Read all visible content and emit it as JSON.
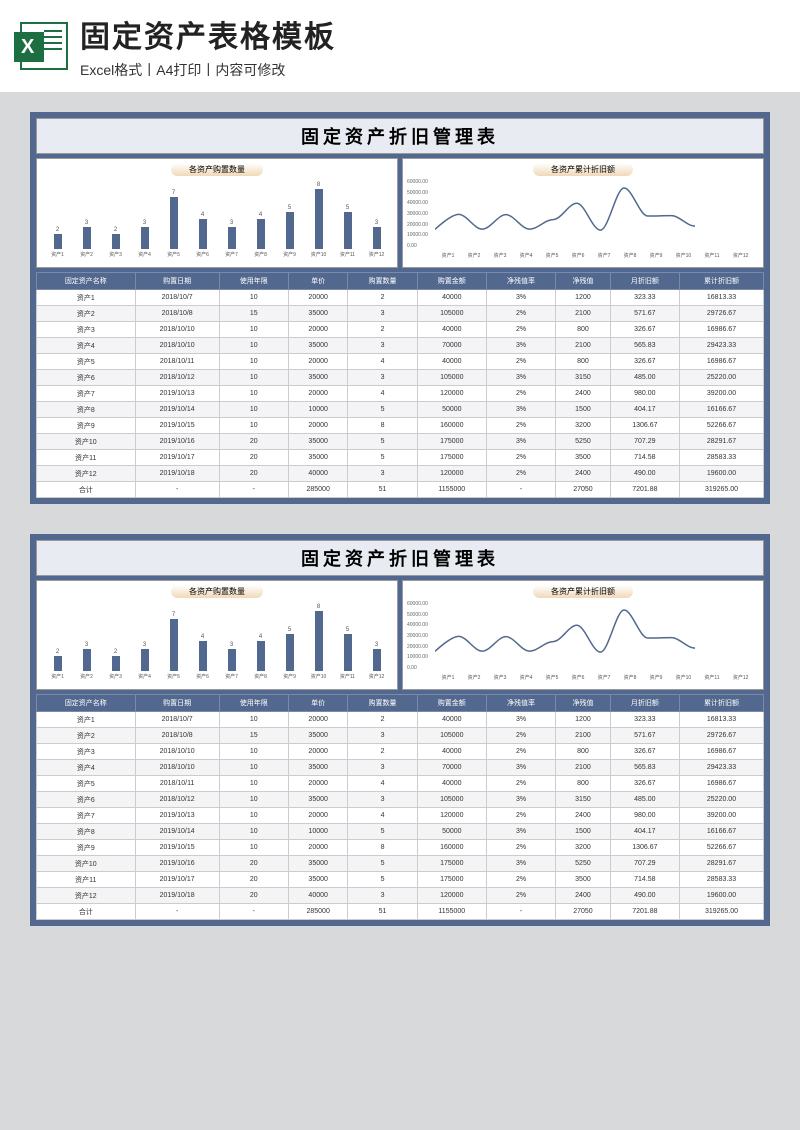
{
  "header": {
    "title": "固定资产表格模板",
    "subtitle": "Excel格式丨A4打印丨内容可修改"
  },
  "sheet": {
    "title": "固定资产折旧管理表",
    "chart1_title": "各资产购置数量",
    "chart2_title": "各资产累计折旧额"
  },
  "chart_data": [
    {
      "type": "bar",
      "title": "各资产购置数量",
      "categories": [
        "资产1",
        "资产2",
        "资产3",
        "资产4",
        "资产5",
        "资产6",
        "资产7",
        "资产8",
        "资产9",
        "资产10",
        "资产11",
        "资产12"
      ],
      "values": [
        2,
        3,
        2,
        3,
        7,
        4,
        3,
        4,
        5,
        8,
        5,
        3
      ],
      "ylim": [
        0,
        8
      ]
    },
    {
      "type": "line",
      "title": "各资产累计折旧额",
      "categories": [
        "资产1",
        "资产2",
        "资产3",
        "资产4",
        "资产5",
        "资产6",
        "资产7",
        "资产8",
        "资产9",
        "资产10",
        "资产11",
        "资产12"
      ],
      "values": [
        16813,
        29726,
        16986,
        29423,
        16986,
        25220,
        39200,
        16166,
        52266,
        28291,
        28583,
        19600
      ],
      "ylim": [
        0,
        60000
      ],
      "yticks": [
        "60000.00",
        "50000.00",
        "40000.00",
        "30000.00",
        "20000.00",
        "10000.00",
        "0.00"
      ]
    }
  ],
  "table": {
    "headers": [
      "固定资产名称",
      "购置日期",
      "使用年限",
      "单价",
      "购置数量",
      "购置金额",
      "净残值率",
      "净残值",
      "月折旧额",
      "累计折旧额"
    ],
    "rows": [
      [
        "资产1",
        "2018/10/7",
        "10",
        "20000",
        "2",
        "40000",
        "3%",
        "1200",
        "323.33",
        "16813.33"
      ],
      [
        "资产2",
        "2018/10/8",
        "15",
        "35000",
        "3",
        "105000",
        "2%",
        "2100",
        "571.67",
        "29726.67"
      ],
      [
        "资产3",
        "2018/10/10",
        "10",
        "20000",
        "2",
        "40000",
        "2%",
        "800",
        "326.67",
        "16986.67"
      ],
      [
        "资产4",
        "2018/10/10",
        "10",
        "35000",
        "3",
        "70000",
        "3%",
        "2100",
        "565.83",
        "29423.33"
      ],
      [
        "资产5",
        "2018/10/11",
        "10",
        "20000",
        "4",
        "40000",
        "2%",
        "800",
        "326.67",
        "16986.67"
      ],
      [
        "资产6",
        "2018/10/12",
        "10",
        "35000",
        "3",
        "105000",
        "3%",
        "3150",
        "485.00",
        "25220.00"
      ],
      [
        "资产7",
        "2019/10/13",
        "10",
        "20000",
        "4",
        "120000",
        "2%",
        "2400",
        "980.00",
        "39200.00"
      ],
      [
        "资产8",
        "2019/10/14",
        "10",
        "10000",
        "5",
        "50000",
        "3%",
        "1500",
        "404.17",
        "16166.67"
      ],
      [
        "资产9",
        "2019/10/15",
        "10",
        "20000",
        "8",
        "160000",
        "2%",
        "3200",
        "1306.67",
        "52266.67"
      ],
      [
        "资产10",
        "2019/10/16",
        "20",
        "35000",
        "5",
        "175000",
        "3%",
        "5250",
        "707.29",
        "28291.67"
      ],
      [
        "资产11",
        "2019/10/17",
        "20",
        "35000",
        "5",
        "175000",
        "2%",
        "3500",
        "714.58",
        "28583.33"
      ],
      [
        "资产12",
        "2019/10/18",
        "20",
        "40000",
        "3",
        "120000",
        "2%",
        "2400",
        "490.00",
        "19600.00"
      ],
      [
        "合计",
        "-",
        "-",
        "285000",
        "51",
        "1155000",
        "-",
        "27050",
        "7201.88",
        "319265.00"
      ]
    ]
  }
}
